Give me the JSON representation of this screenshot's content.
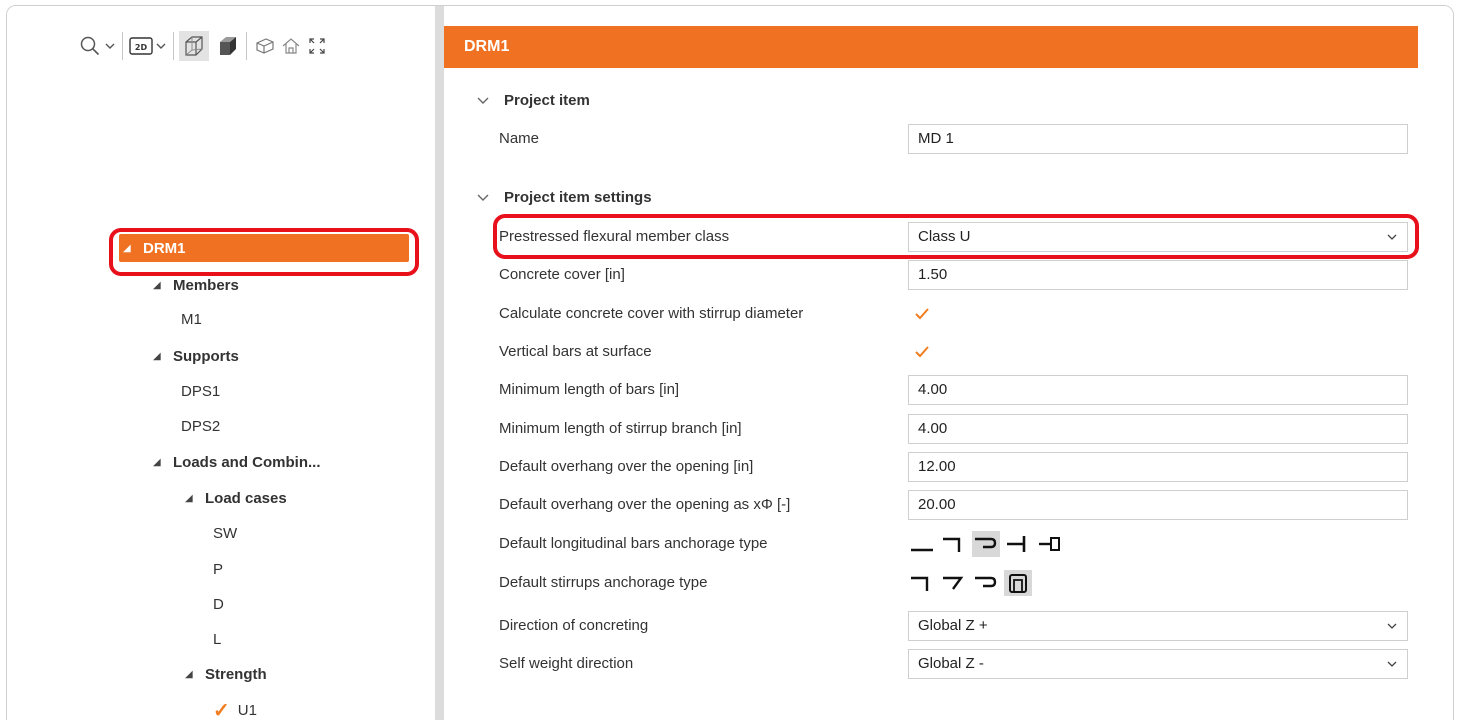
{
  "toolbar": {
    "icons": [
      "search-icon",
      "view-2d-icon",
      "wireframe-cube-icon",
      "solid-cube-icon",
      "perspective-icon",
      "home-icon",
      "fullscreen-icon"
    ],
    "view_2d_label": "2D"
  },
  "tree": {
    "root": "DRM1",
    "members": {
      "label": "Members",
      "items": [
        "M1"
      ]
    },
    "supports": {
      "label": "Supports",
      "items": [
        "DPS1",
        "DPS2"
      ]
    },
    "loads": {
      "label": "Loads and Combin..."
    },
    "load_cases": {
      "label": "Load cases",
      "items": [
        "SW",
        "P",
        "D",
        "L"
      ]
    },
    "strength": {
      "label": "Strength",
      "items": [
        "U1"
      ]
    }
  },
  "panel": {
    "title": "DRM1",
    "section_project_item": "Project item",
    "name_label": "Name",
    "name_value": "MD 1",
    "section_settings": "Project item settings",
    "rows": [
      {
        "label": "Prestressed flexural member class",
        "value": "Class U",
        "type": "select"
      },
      {
        "label": "Concrete cover [in]",
        "value": "1.50",
        "type": "input"
      },
      {
        "label": "Calculate concrete cover with stirrup diameter",
        "checked": true,
        "type": "checkbox"
      },
      {
        "label": "Vertical bars at surface",
        "checked": true,
        "type": "checkbox"
      },
      {
        "label": "Minimum length of bars [in]",
        "value": "4.00",
        "type": "input"
      },
      {
        "label": "Minimum length of stirrup branch [in]",
        "value": "4.00",
        "type": "input"
      },
      {
        "label": "Default overhang over the opening [in]",
        "value": "12.00",
        "type": "input"
      },
      {
        "label": "Default overhang over the opening as xΦ [-]",
        "value": "20.00",
        "type": "input"
      },
      {
        "label": "Default longitudinal bars anchorage type",
        "type": "icons",
        "selected": 2
      },
      {
        "label": "Default stirrups anchorage type",
        "type": "icons",
        "selected": 3
      },
      {
        "label": "Direction of concreting",
        "value": "Global Z +",
        "type": "select"
      },
      {
        "label": "Self weight direction",
        "value": "Global Z -",
        "type": "select"
      }
    ]
  },
  "colors": {
    "accent": "#f07122",
    "highlight": "#e8101a",
    "check": "#f07d20"
  }
}
